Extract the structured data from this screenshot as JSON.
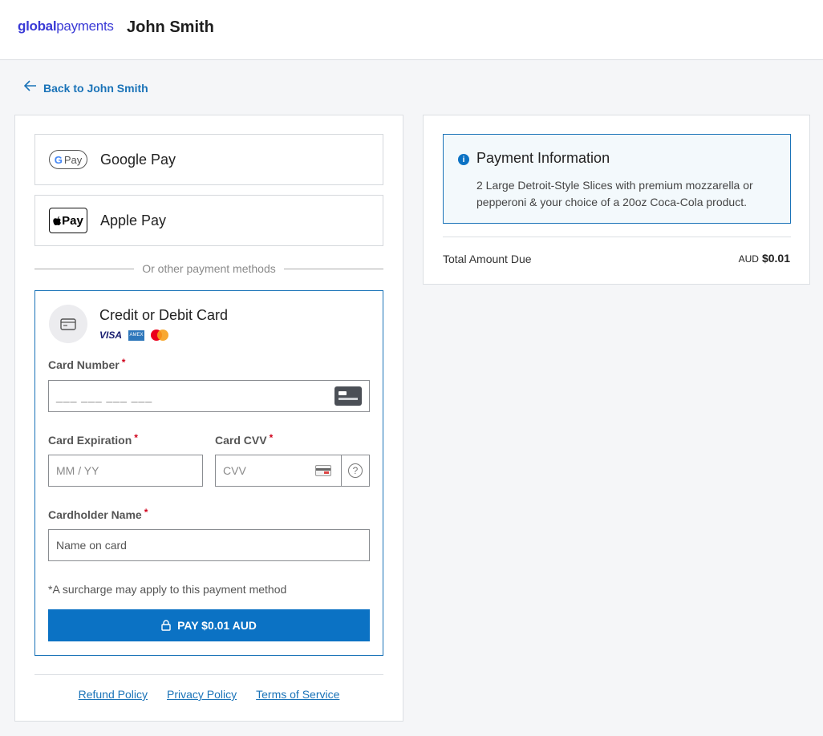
{
  "header": {
    "logo_prefix": "global",
    "logo_suffix": "payments",
    "merchant_name": "John Smith"
  },
  "nav": {
    "back_label": "Back to John Smith"
  },
  "wallets": {
    "google_pay_label": "Google Pay",
    "google_pay_icon_text": "Pay",
    "google_pay_icon_g": "G",
    "apple_pay_label": "Apple Pay",
    "apple_pay_icon_text": "Pay",
    "apple_pay_icon_logo": ""
  },
  "divider_text": "Or other payment methods",
  "card_form": {
    "title": "Credit or Debit Card",
    "brands": {
      "visa": "VISA",
      "amex": "AMEX"
    },
    "card_number_label": "Card Number",
    "card_number_placeholder": "___ ___ ___ ___",
    "expiration_label": "Card Expiration",
    "expiration_placeholder": "MM / YY",
    "cvv_label": "Card CVV",
    "cvv_placeholder": "CVV",
    "cvv_help": "?",
    "cardholder_label": "Cardholder Name",
    "cardholder_placeholder": "Name on card",
    "required_marker": "*",
    "surcharge_note": "*A surcharge may apply to this payment method",
    "pay_button": "PAY $0.01 AUD"
  },
  "footer": {
    "refund": "Refund Policy",
    "privacy": "Privacy Policy",
    "terms": "Terms of Service"
  },
  "payment_info": {
    "title": "Payment Information",
    "icon": "i",
    "description": "2 Large Detroit-Style Slices with premium mozzarella or pepperoni & your choice of a 20oz Coca-Cola product.",
    "total_label": "Total Amount Due",
    "total_currency": "AUD",
    "total_amount": "$0.01"
  },
  "colors": {
    "accent": "#0b72c4",
    "link": "#1a73b8",
    "required": "#d0021b"
  }
}
